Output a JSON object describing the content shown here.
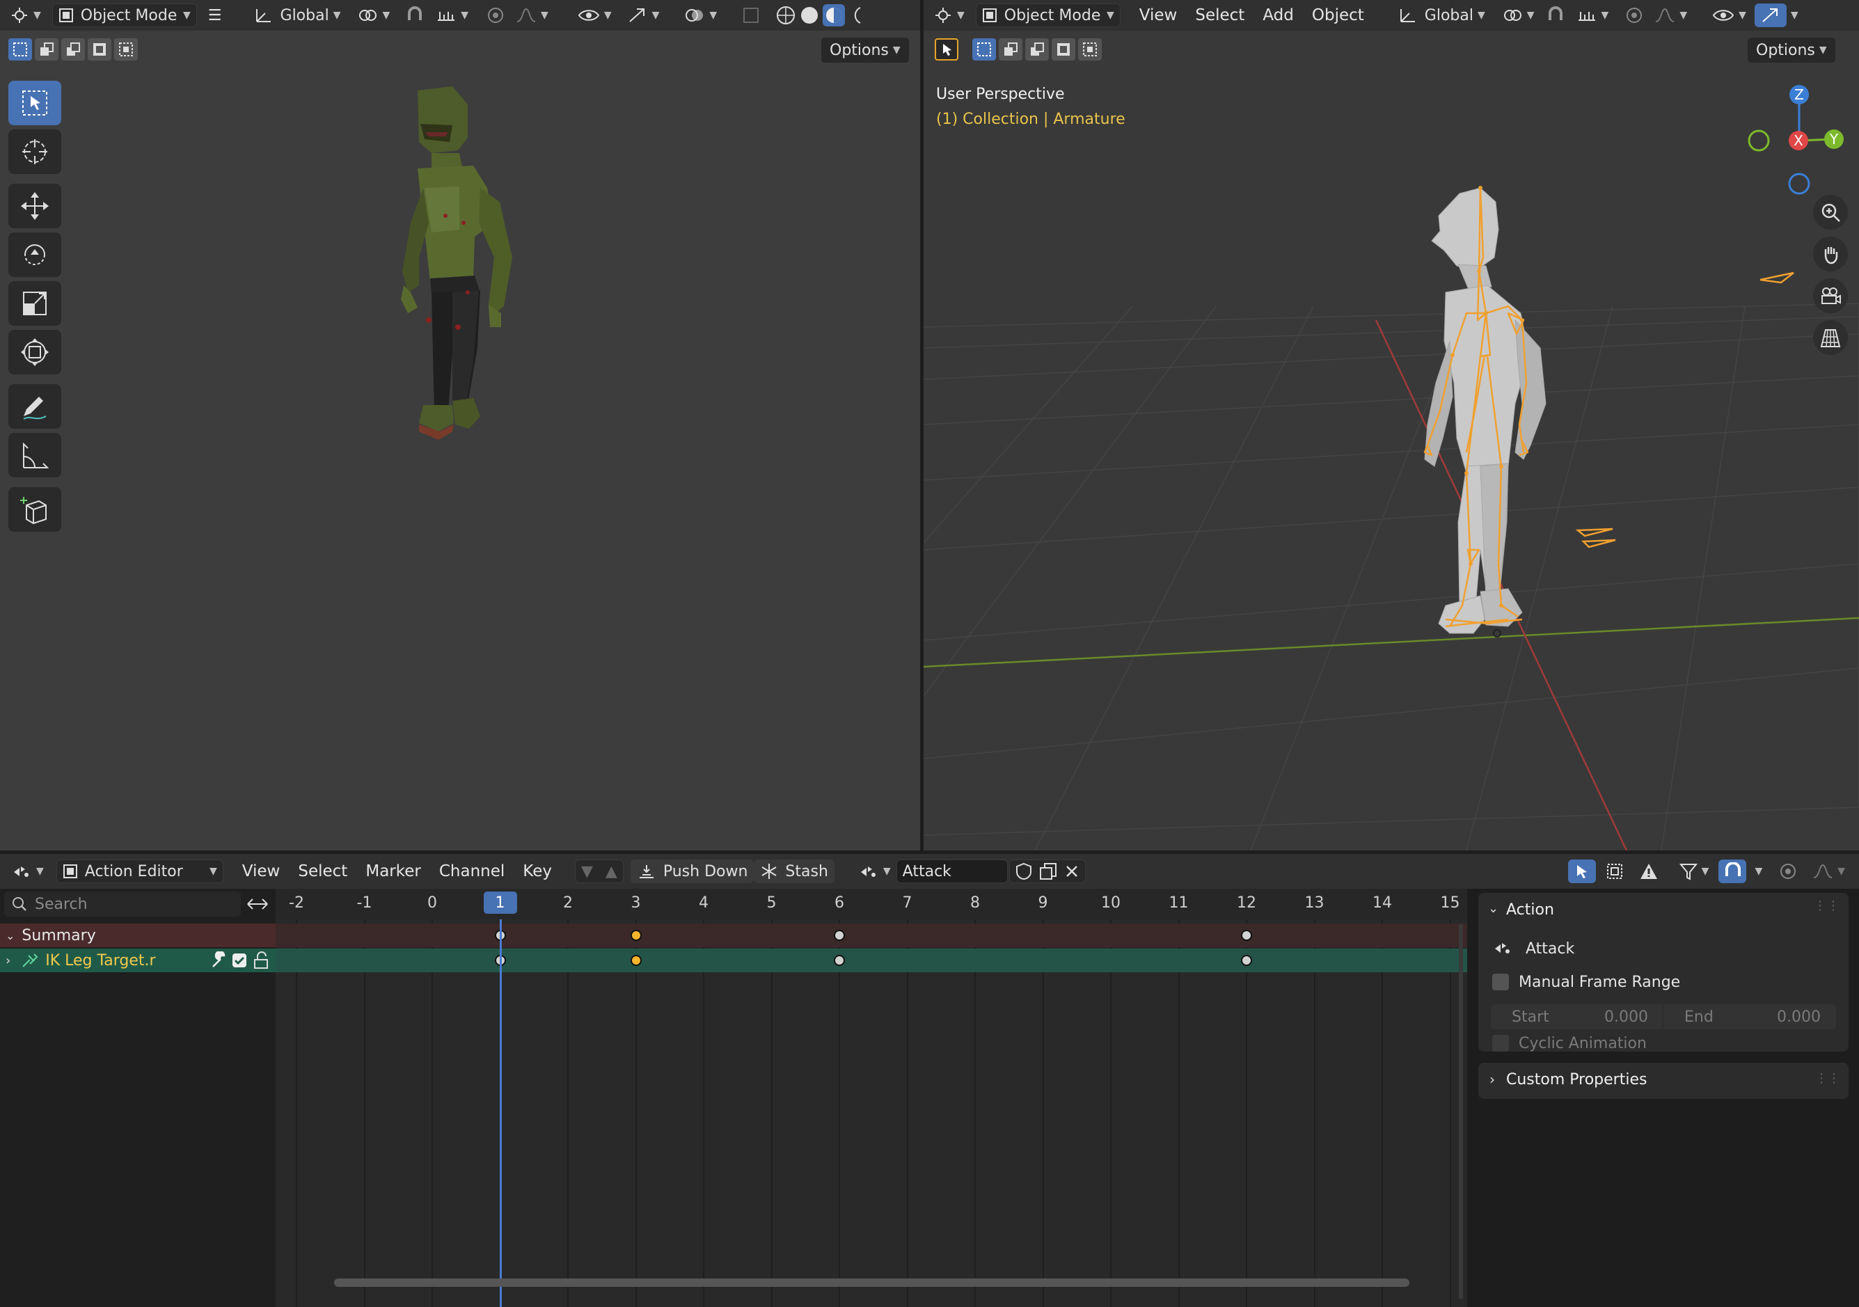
{
  "left_viewport": {
    "mode": "Object Mode",
    "orientation": "Global",
    "options_label": "Options"
  },
  "right_viewport": {
    "mode": "Object Mode",
    "menu": [
      "View",
      "Select",
      "Add",
      "Object"
    ],
    "orientation": "Global",
    "options_label": "Options",
    "perspective": "User Perspective",
    "collection": "(1) Collection | Armature",
    "gizmo_axes": [
      "Z",
      "X",
      "Y"
    ]
  },
  "action_editor": {
    "editor_mode": "Action Editor",
    "menu": [
      "View",
      "Select",
      "Marker",
      "Channel",
      "Key"
    ],
    "push_down_label": "Push Down",
    "stash_label": "Stash",
    "action_name": "Attack",
    "search_placeholder": "Search",
    "channels": [
      {
        "label": "Summary"
      },
      {
        "label": "IK Leg Target.r"
      }
    ],
    "ruler_frames": [
      "-2",
      "-1",
      "0",
      "1",
      "2",
      "3",
      "4",
      "5",
      "6",
      "7",
      "8",
      "9",
      "10",
      "11",
      "12",
      "13",
      "14",
      "15"
    ],
    "current_frame": "1",
    "keyframes": [
      {
        "frame": 1,
        "selected": false
      },
      {
        "frame": 3,
        "selected": true
      },
      {
        "frame": 6,
        "selected": false
      },
      {
        "frame": 12,
        "selected": false
      }
    ],
    "sidebar": {
      "action_panel_title": "Action",
      "action_name": "Attack",
      "manual_frame_range_label": "Manual Frame Range",
      "start_label": "Start",
      "start_value": "0.000",
      "end_label": "End",
      "end_value": "0.000",
      "cyclic_label": "Cyclic Animation",
      "custom_props_title": "Custom Properties"
    }
  },
  "colors": {
    "accent": "#4772b3",
    "summary_row": "#4a2a2a",
    "channel_row": "#1f5a48",
    "keyframe_selected": "#f5b52d",
    "keyframe_unselected": "#d2d2d2",
    "bone_orange": "#f0a030"
  }
}
